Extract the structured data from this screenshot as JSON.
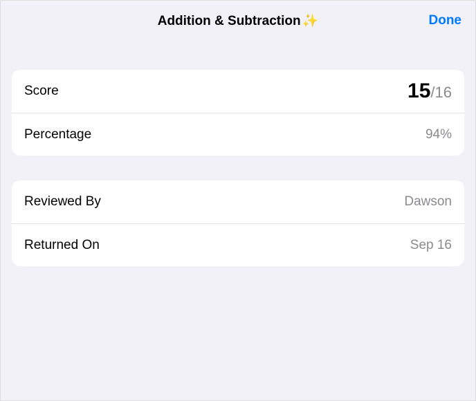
{
  "header": {
    "title": "Addition & Subtraction",
    "sparkles": "✨",
    "done": "Done"
  },
  "scoreCard": {
    "scoreLabel": "Score",
    "scoreEarned": "15",
    "scoreSlash": "/",
    "scoreTotal": "16",
    "percentageLabel": "Percentage",
    "percentageValue": "94%"
  },
  "detailCard": {
    "reviewedByLabel": "Reviewed By",
    "reviewedByValue": "Dawson",
    "returnedOnLabel": "Returned On",
    "returnedOnValue": "Sep 16"
  }
}
